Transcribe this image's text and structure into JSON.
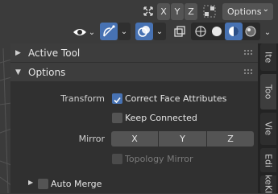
{
  "header": {
    "axis_x": "X",
    "axis_y": "Y",
    "axis_z": "Z",
    "options_label": "Options",
    "icons": [
      "mirror-axes-icon",
      "symmetry-lock-icon",
      "view-eye-icon",
      "gizmo-icon",
      "overlay-icon",
      "xray-icon",
      "shading-wireframe-icon",
      "shading-solid-icon",
      "shading-material-icon",
      "shading-rendered-icon"
    ]
  },
  "panel": {
    "active_tool_label": "Active Tool",
    "options_label": "Options",
    "transform_label": "Transform",
    "correct_face_attributes": "Correct Face Attributes",
    "keep_connected": "Keep Connected",
    "mirror_label": "Mirror",
    "mirror_x": "X",
    "mirror_y": "Y",
    "mirror_z": "Z",
    "topology_mirror": "Topology Mirror",
    "auto_merge": "Auto Merge"
  },
  "tabs": [
    "Ite",
    "Too",
    "Vie",
    "Edi",
    "keKI"
  ],
  "colors": {
    "accent": "#4772b3",
    "panel_bg": "#303030",
    "header_bg": "#3d3d3d"
  }
}
